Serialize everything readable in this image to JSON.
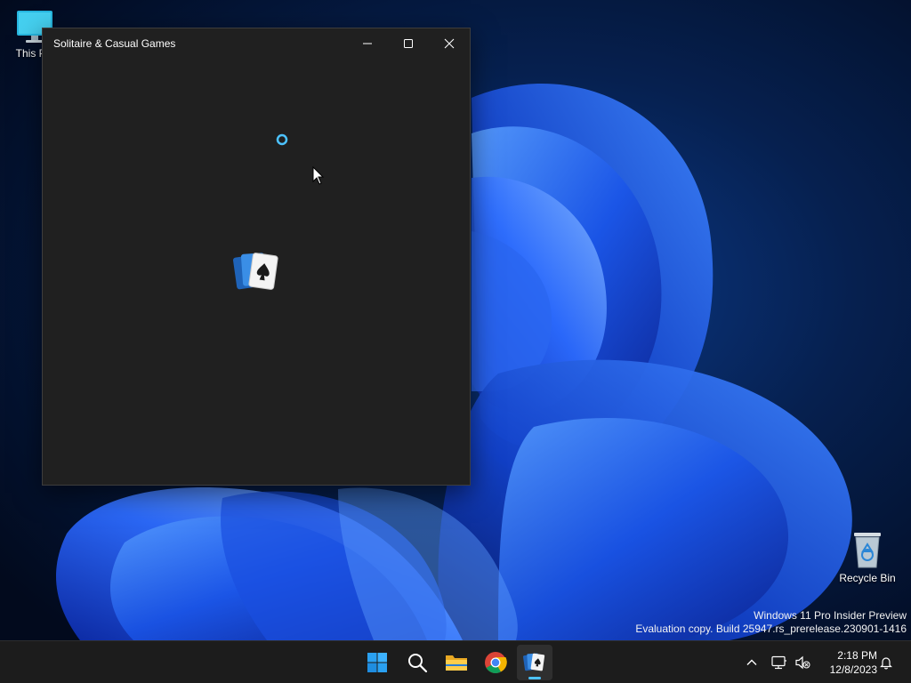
{
  "desktop": {
    "this_pc_label": "This PC",
    "recycle_bin_label": "Recycle Bin"
  },
  "watermark": {
    "line1": "Windows 11 Pro Insider Preview",
    "line2": "Evaluation copy. Build 25947.rs_prerelease.230901-1416"
  },
  "window": {
    "title": "Solitaire & Casual Games",
    "minimize_icon": "minimize-icon",
    "maximize_icon": "maximize-icon",
    "close_icon": "close-icon",
    "splash_icon": "solitaire-cards-icon",
    "loading_icon": "loading-ring-icon"
  },
  "taskbar": {
    "items": [
      {
        "name": "start",
        "icon": "windows-logo-icon"
      },
      {
        "name": "search",
        "icon": "search-icon"
      },
      {
        "name": "file-explorer",
        "icon": "folder-icon"
      },
      {
        "name": "chrome",
        "icon": "chrome-icon"
      },
      {
        "name": "solitaire",
        "icon": "solitaire-cards-icon",
        "active": true
      }
    ],
    "tray": {
      "chevron_icon": "chevron-up-icon",
      "network_icon": "network-icon",
      "volume_icon": "volume-muted-icon",
      "notification_icon": "bell-icon"
    },
    "clock": {
      "time": "2:18 PM",
      "date": "12/8/2023"
    }
  },
  "colors": {
    "accent": "#4cc2ff",
    "window_bg": "#202020",
    "taskbar_bg": "#1c1c1c"
  }
}
